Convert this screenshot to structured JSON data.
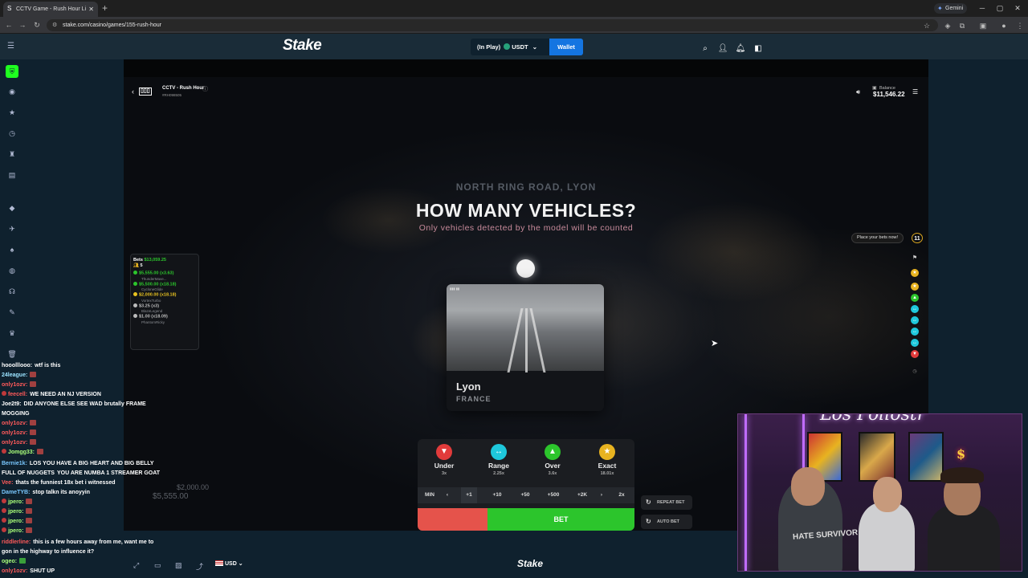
{
  "browser": {
    "tab_title": "CCTV Game - Rush Hour Li",
    "url": "stake.com/casino/games/155-rush-hour",
    "gemini_label": "Gemini"
  },
  "header": {
    "logo": "Stake",
    "wallet_status": "(In Play)",
    "currency": "USDT",
    "wallet_button": "Wallet"
  },
  "game": {
    "title": "CCTV - Rush Hour",
    "game_id": "#RH098505",
    "balance_label": "Balance",
    "balance_value": "$11,546.22",
    "road_label": "NORTH RING ROAD, LYON",
    "question": "HOW MANY VEHICLES?",
    "subtitle": "Only vehicles detected by the model will be counted",
    "place_bets": "Place your bets now!",
    "timer": "11",
    "city": "Lyon",
    "country": "FRANCE",
    "ghost_amount_1": "$2,000.00",
    "ghost_amount_2": "$5,555.00"
  },
  "bets_panel": {
    "header_label": "Bets",
    "header_total": "$13,059.25",
    "player_count": "5",
    "entries": [
      {
        "amount": "$5,555.00 (x3.63)",
        "user": "ThunderMave...",
        "color": "#2cc52c"
      },
      {
        "amount": "$5,500.00 (x18.18)",
        "user": "CycloneGlide",
        "color": "#2cc52c"
      },
      {
        "amount": "$2,000.00 (x18.18)",
        "user": "VortexTurbo",
        "color": "#e8c220"
      },
      {
        "amount": "$3.25 (x3)",
        "user": "BlazeLegend",
        "color": "#bbbbbb"
      },
      {
        "amount": "$1.00 (x18.09)",
        "user": "PhantomRicky",
        "color": "#bbbbbb"
      }
    ]
  },
  "options": [
    {
      "name": "Under",
      "mult": "3x",
      "color": "#e13b3b",
      "icon": "▼"
    },
    {
      "name": "Range",
      "mult": "2.25x",
      "color": "#1ec8dc",
      "icon": "↔"
    },
    {
      "name": "Over",
      "mult": "3.6x",
      "color": "#2cc52c",
      "icon": "▲"
    },
    {
      "name": "Exact",
      "mult": "18.01x",
      "color": "#e8b320",
      "icon": "★"
    }
  ],
  "chips": [
    "MIN",
    "‹",
    "+1",
    "+10",
    "+50",
    "+500",
    "+2K",
    "›",
    "2x"
  ],
  "bet_button": "BET",
  "repeat_bet": "REPEAT BET",
  "auto_bet": "AUTO BET",
  "bottom": {
    "currency": "USD",
    "logo": "Stake"
  },
  "chat": [
    {
      "user": "hooolllooo:",
      "msg": "wtf is this",
      "ucolor": "#ffffff"
    },
    {
      "user": "24league:",
      "msg": "",
      "ucolor": "#9be3ff"
    },
    {
      "user": "only1ozv:",
      "msg": "",
      "ucolor": "#ff5a5a"
    },
    {
      "user": "feecell:",
      "msg": "WE NEED AN NJ VERSION",
      "ucolor": "#ff5a5a"
    },
    {
      "user": "Joe2t9:",
      "msg": "DID ANYONE ELSE SEE WAD brutally FRAME",
      "ucolor": "#ffffff"
    },
    {
      "user": "MOGGING",
      "msg": "",
      "ucolor": "#ffffff"
    },
    {
      "user": "only1ozv:",
      "msg": "",
      "ucolor": "#ff5a5a"
    },
    {
      "user": "only1ozv:",
      "msg": "",
      "ucolor": "#ff5a5a"
    },
    {
      "user": "only1ozv:",
      "msg": "",
      "ucolor": "#ff5a5a"
    },
    {
      "user": "Jomgg33:",
      "msg": "",
      "ucolor": "#aaff7a"
    },
    {
      "user": "Bernie1k:",
      "msg": "LOS YOU HAVE A BIG HEART AND BIG BELLY",
      "ucolor": "#7ac8ff"
    },
    {
      "user": "FULL OF NUGGETS",
      "msg": "YOU ARE NUMBA 1 STREAMER GOAT",
      "ucolor": "#ffffff"
    },
    {
      "user": "Vee:",
      "msg": "thats the funniest 18x bet i witnessed",
      "ucolor": "#ff5a5a"
    },
    {
      "user": "DameTYB:",
      "msg": "stop talkn its anoyyin",
      "ucolor": "#7ac8ff"
    },
    {
      "user": "jpero:",
      "msg": "",
      "ucolor": "#aaff7a"
    },
    {
      "user": "jpero:",
      "msg": "",
      "ucolor": "#aaff7a"
    },
    {
      "user": "jpero:",
      "msg": "",
      "ucolor": "#aaff7a"
    },
    {
      "user": "jpero:",
      "msg": "",
      "ucolor": "#aaff7a"
    },
    {
      "user": "riddlerline:",
      "msg": "this is a few hours away from me, want me to",
      "ucolor": "#ff5a5a"
    },
    {
      "user": "go",
      "msg": "n in the highway to influence it?",
      "ucolor": "#ffffff"
    },
    {
      "user": "ogeo:",
      "msg": "",
      "ucolor": "#aaff7a"
    },
    {
      "user": "only1ozv:",
      "msg": "SHUT UP",
      "ucolor": "#ff5a5a"
    }
  ],
  "webcam": {
    "sign": "Los Pollostr",
    "hoodie": "HATE\nSURVIVOR"
  }
}
